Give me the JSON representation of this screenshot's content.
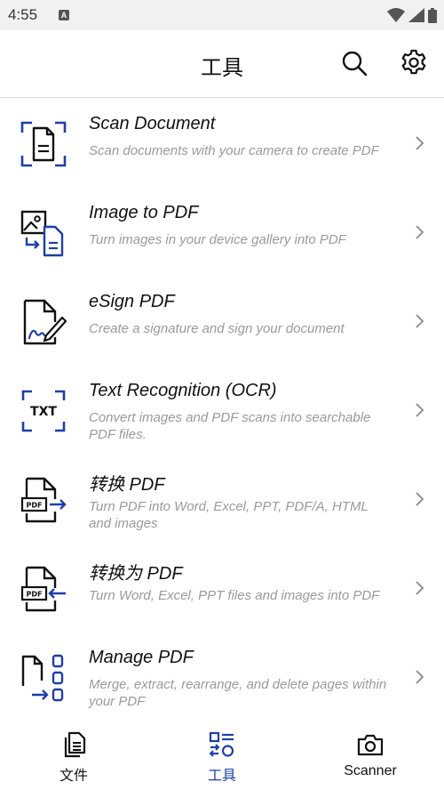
{
  "status_bar": {
    "time": "4:55",
    "notification": "A"
  },
  "header": {
    "title": "工具"
  },
  "tools": [
    {
      "title": "Scan Document",
      "description": "Scan documents with your camera to create PDF"
    },
    {
      "title": "Image to PDF",
      "description": "Turn images in your device gallery into PDF"
    },
    {
      "title": "eSign PDF",
      "description": "Create a signature and sign your document"
    },
    {
      "title": "Text Recognition (OCR)",
      "description": "Convert images and PDF scans into searchable PDF files.",
      "icon_text": "TXT"
    },
    {
      "title": "转换 PDF",
      "description": "Turn PDF into Word, Excel, PPT, PDF/A, HTML and images",
      "icon_text": "PDF"
    },
    {
      "title": "转换为 PDF",
      "description": "Turn Word, Excel, PPT files and images into PDF",
      "icon_text": "PDF"
    },
    {
      "title": "Manage PDF",
      "description": "Merge, extract, rearrange, and delete pages within your PDF"
    }
  ],
  "bottom_nav": [
    {
      "label": "文件",
      "icon": "files-icon"
    },
    {
      "label": "工具",
      "icon": "tools-icon",
      "active": true
    },
    {
      "label": "Scanner",
      "icon": "camera-icon"
    }
  ],
  "colors": {
    "accent": "#1f3fa8",
    "text": "#111111",
    "muted": "#9a9a9a",
    "divider": "#d7d7d7"
  }
}
